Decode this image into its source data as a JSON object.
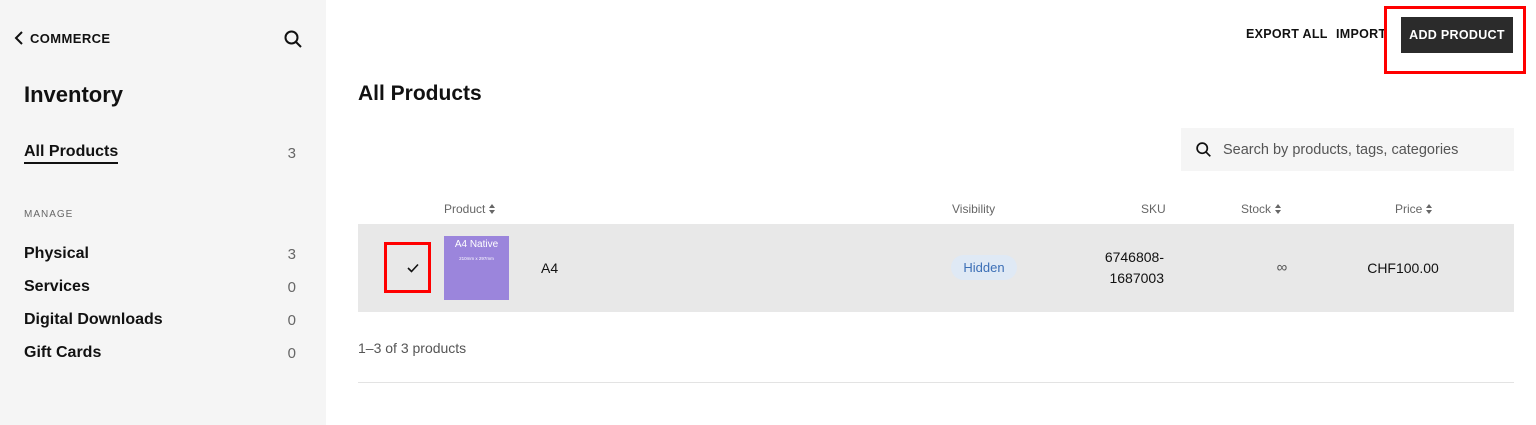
{
  "sidebar": {
    "back_label": "COMMERCE",
    "title": "Inventory",
    "all_products": {
      "label": "All Products",
      "count": "3"
    },
    "section_label": "MANAGE",
    "items": [
      {
        "label": "Physical",
        "count": "3"
      },
      {
        "label": "Services",
        "count": "0"
      },
      {
        "label": "Digital Downloads",
        "count": "0"
      },
      {
        "label": "Gift Cards",
        "count": "0"
      }
    ]
  },
  "toolbar": {
    "export_label": "EXPORT ALL",
    "import_label": "IMPORT",
    "add_label": "ADD PRODUCT"
  },
  "main": {
    "title": "All Products",
    "search": {
      "placeholder": "Search by products, tags, categories",
      "value": ""
    },
    "columns": {
      "product": "Product",
      "visibility": "Visibility",
      "sku": "SKU",
      "stock": "Stock",
      "price": "Price"
    },
    "rows": [
      {
        "thumb_title": "A4 Native",
        "thumb_sub": "210mm x 297mm",
        "name": "A4",
        "visibility": "Hidden",
        "sku_line1": "6746808-",
        "sku_line2": "1687003",
        "stock": "∞",
        "price": "CHF100.00",
        "checked": true
      }
    ],
    "count_text": "1–3 of 3 products"
  },
  "colors": {
    "accent_button": "#2b2b2b",
    "highlight_box": "#ff0000",
    "thumbnail": "#9b85dc",
    "badge_bg": "#dfe9f5",
    "badge_text": "#3c6fb6"
  },
  "icons": [
    "chevron-left-icon",
    "search-icon",
    "sort-icon",
    "checkmark-icon"
  ]
}
